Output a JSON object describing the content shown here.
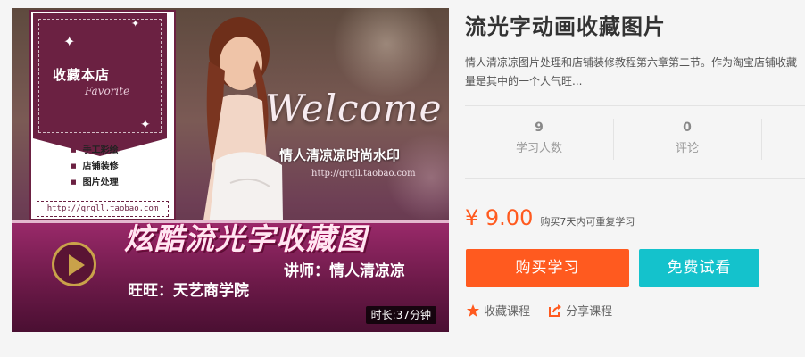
{
  "thumbnail": {
    "badge_title": "收藏本店",
    "badge_sub": "Favorite",
    "badge_items": [
      "手工彩绘",
      "店铺装修",
      "图片处理"
    ],
    "badge_url": "http://qrqll.taobao.com",
    "welcome_text": "Welcome",
    "watermark_name": "情人清凉凉时尚水印",
    "watermark_url": "http://qrqll.taobao.com",
    "banner_title": "炫酷流光字收藏图",
    "wangwang": "旺旺：天艺商学院",
    "teacher": "讲师：情人清凉凉",
    "duration": "时长:37分钟"
  },
  "course": {
    "title": "流光字动画收藏图片",
    "description": "情人清凉凉图片处理和店铺装修教程第六章第二节。作为淘宝店铺收藏量是其中的一个人气旺...",
    "stats": [
      {
        "value": "9",
        "label": "学习人数"
      },
      {
        "value": "0",
        "label": "评论"
      }
    ],
    "price": "¥ 9.00",
    "price_note": "购买7天内可重复学习",
    "buy_label": "购买学习",
    "trial_label": "免费试看",
    "favorite_label": "收藏课程",
    "share_label": "分享课程"
  },
  "colors": {
    "accent_orange": "#ff5a1f",
    "accent_cyan": "#14c2cc",
    "thumbnail_purple": "#6b2142"
  },
  "icons": [
    "star-icon",
    "share-icon",
    "play-icon",
    "sparkle-icon"
  ]
}
